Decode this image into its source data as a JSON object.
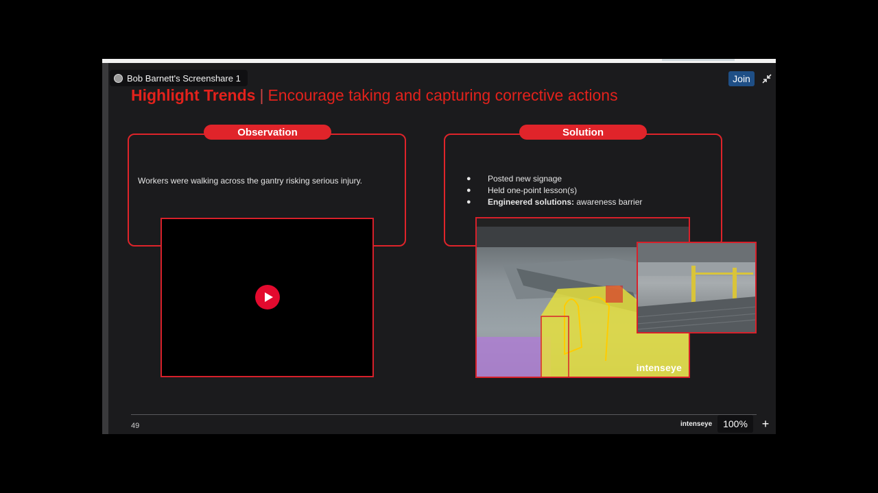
{
  "screenshare": {
    "label": "Bob Barnett's Screenshare 1",
    "join_label": "Join",
    "zoom": "100%",
    "plus_label": "+"
  },
  "slide": {
    "title_bold": "Highlight Trends",
    "title_sep": "|",
    "title_rest": "Encourage taking and capturing corrective actions",
    "observation": {
      "label": "Observation",
      "text": "Workers were walking across the gantry risking serious injury."
    },
    "solution": {
      "label": "Solution",
      "bullets": [
        {
          "bold": "",
          "text": "Posted new signage"
        },
        {
          "bold": "",
          "text": "Held one-point lesson(s)"
        },
        {
          "bold": "Engineered solutions:",
          "text": " awareness barrier"
        }
      ]
    },
    "camera_watermark": "intenseye",
    "page_number": "49",
    "footer_brand": "intenseye"
  },
  "colors": {
    "accent": "#e0242a",
    "title_red": "#e3221c",
    "join_blue": "#1f4f86",
    "play_red": "#e30a2e",
    "overlay_yellow": "#e8e23a",
    "overlay_purple": "#b07ad8"
  },
  "icons": {
    "avatar": "user-avatar-icon",
    "collapse": "collapse-arrows-icon",
    "play": "play-icon"
  }
}
